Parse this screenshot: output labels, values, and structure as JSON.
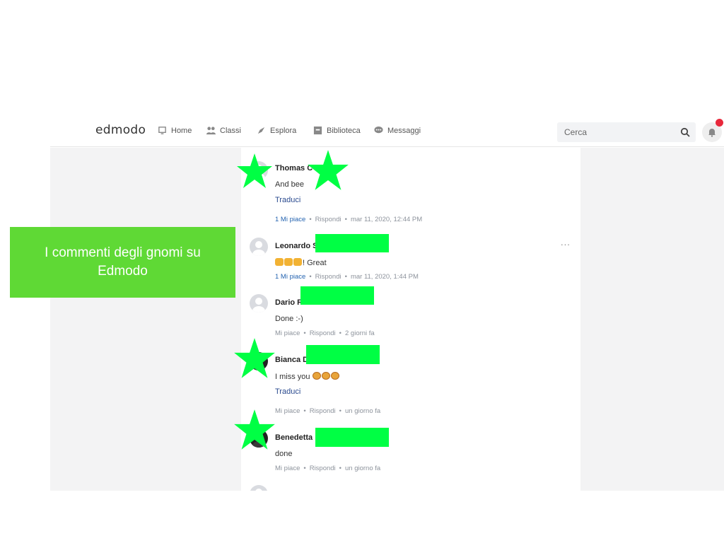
{
  "app": {
    "logo": "edmodo",
    "nav": [
      {
        "label": "Home",
        "icon": "home-icon"
      },
      {
        "label": "Classi",
        "icon": "classes-icon"
      },
      {
        "label": "Esplora",
        "icon": "explore-icon"
      },
      {
        "label": "Biblioteca",
        "icon": "library-icon"
      },
      {
        "label": "Messaggi",
        "icon": "messages-icon"
      }
    ],
    "search_placeholder": "Cerca",
    "notification_icon": "bell-icon"
  },
  "overlay": {
    "caption": "I commenti degli gnomi su Edmodo",
    "caption_color": "#5fd935",
    "star_color": "#00ff44",
    "redaction_color": "#00ff44"
  },
  "comments": [
    {
      "name": "Thomas C",
      "text": "And bee",
      "translate": "Traduci",
      "likes": "1 Mi piace",
      "reply": "Rispondi",
      "time": "mar 11, 2020, 12:44 PM"
    },
    {
      "name": "Leonardo S",
      "text": "! Great",
      "emoji": "clapping-hands-icon",
      "likes": "1 Mi piace",
      "reply": "Rispondi",
      "time": "mar 11, 2020, 1:44 PM",
      "more": "..."
    },
    {
      "name": "Dario R",
      "text": "Done :-)",
      "likes": "Mi piace",
      "reply": "Rispondi",
      "time": "2 giorni fa"
    },
    {
      "name": "Bianca D",
      "text": "I miss you",
      "emoji": "crying-face-icon",
      "translate": "Traduci",
      "likes": "Mi piace",
      "reply": "Rispondi",
      "time": "un giorno fa"
    },
    {
      "name": "Benedetta",
      "text": "done",
      "likes": "Mi piace",
      "reply": "Rispondi",
      "time": "un giorno fa"
    }
  ]
}
